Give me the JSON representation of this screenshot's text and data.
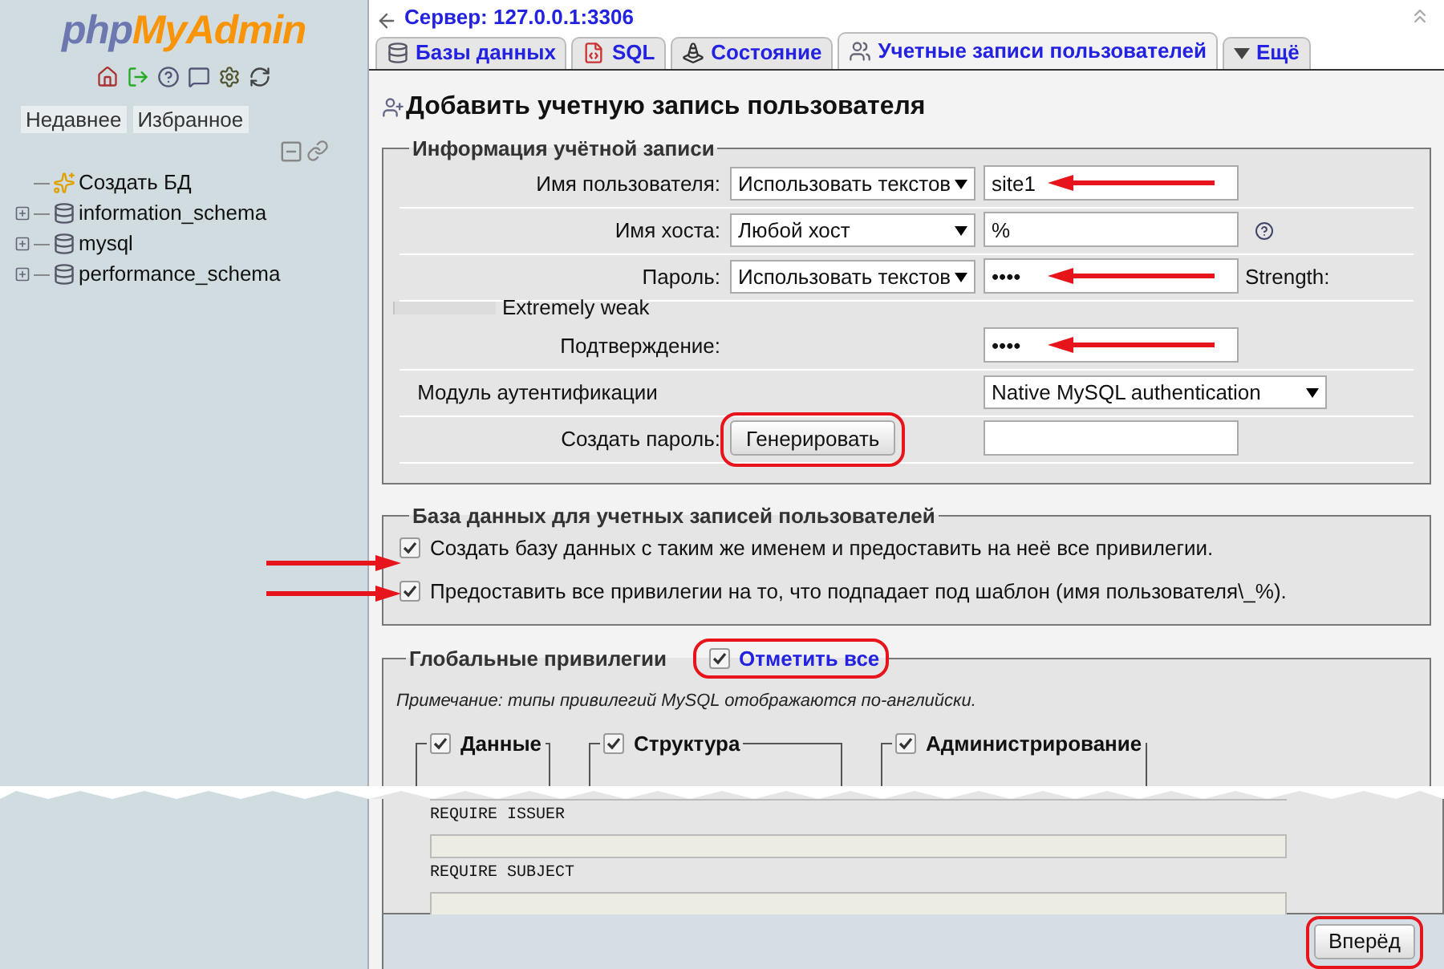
{
  "logo": {
    "part1": "php",
    "part2": "MyAdmin"
  },
  "sidebar": {
    "tabs": [
      "Недавнее",
      "Избранное"
    ],
    "tree": [
      {
        "label": "Создать БД",
        "kind": "new"
      },
      {
        "label": "information_schema",
        "kind": "db"
      },
      {
        "label": "mysql",
        "kind": "db"
      },
      {
        "label": "performance_schema",
        "kind": "db"
      }
    ]
  },
  "server": "Сервер: 127.0.0.1:3306",
  "tabs": [
    {
      "label": "Базы данных",
      "selected": false
    },
    {
      "label": "SQL",
      "selected": false
    },
    {
      "label": "Состояние",
      "selected": false
    },
    {
      "label": "Учетные записи пользователей",
      "selected": true
    },
    {
      "label": "Ещё",
      "selected": false
    }
  ],
  "heading": "Добавить учетную запись пользователя",
  "account": {
    "legend": "Информация учётной записи",
    "rows": [
      {
        "label": "Имя пользователя:",
        "select": "Использовать текстов",
        "value": "site1",
        "arrow": true
      },
      {
        "label": "Имя хоста:",
        "select": "Любой хост",
        "value": "%",
        "help": true,
        "arrow": false
      },
      {
        "label": "Пароль:",
        "select": "Использовать текстов",
        "value": "••••",
        "extra": "Strength:",
        "arrow": true
      },
      {
        "kind": "strength",
        "text": "Extremely weak",
        "level": 0
      },
      {
        "label": "Подтверждение:",
        "value": "••••",
        "arrow": true
      },
      {
        "label": "Модуль аутентификации",
        "wide_select": "Native MySQL authentication"
      },
      {
        "label": "Создать пароль:",
        "button": "Генерировать",
        "circled": true,
        "value": ""
      }
    ]
  },
  "database": {
    "legend": "База данных для учетных записей пользователей",
    "options": [
      {
        "label": "Создать базу данных с таким же именем и предоставить на неё все привилегии.",
        "checked": true,
        "arrow": true
      },
      {
        "label": "Предоставить все привилегии на то, что подпадает под шаблон (имя пользователя\\_%).",
        "checked": true,
        "arrow": true
      }
    ]
  },
  "global": {
    "legend": "Глобальные привилегии",
    "select_all": {
      "label": "Отметить все",
      "checked": true,
      "circled": true
    },
    "note": "Примечание: типы привилегий MySQL отображаются по-английски.",
    "groups": [
      {
        "label": "Данные",
        "checked": true
      },
      {
        "label": "Структура",
        "checked": true
      },
      {
        "label": "Администрирование",
        "checked": true
      }
    ]
  },
  "ssl_fields": [
    {
      "label": "REQUIRE ISSUER"
    },
    {
      "label": "REQUIRE SUBJECT"
    }
  ],
  "submit": {
    "label": "Вперёд",
    "circled": true
  }
}
